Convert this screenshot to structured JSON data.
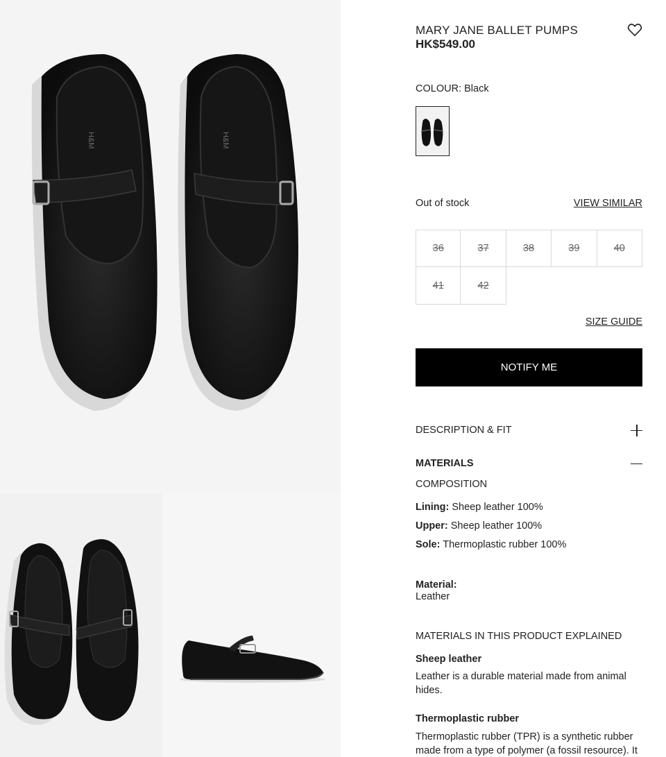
{
  "product": {
    "title": "MARY JANE BALLET PUMPS",
    "price": "HK$549.00"
  },
  "colour": {
    "label": "COLOUR:",
    "value": "Black"
  },
  "stock": {
    "status": "Out of stock",
    "view_similar": "VIEW SIMILAR"
  },
  "sizes": [
    "36",
    "37",
    "38",
    "39",
    "40",
    "41",
    "42"
  ],
  "size_guide": "SIZE GUIDE",
  "notify_button": "NOTIFY ME",
  "accordion": {
    "description": "DESCRIPTION & FIT",
    "materials": "MATERIALS"
  },
  "materials": {
    "composition_heading": "COMPOSITION",
    "composition": [
      {
        "part": "Lining:",
        "value": "Sheep leather 100%"
      },
      {
        "part": "Upper:",
        "value": "Sheep leather 100%"
      },
      {
        "part": "Sole:",
        "value": "Thermoplastic rubber 100%"
      }
    ],
    "material_label": "Material:",
    "material_value": "Leather",
    "explained_heading": "MATERIALS IN THIS PRODUCT EXPLAINED",
    "explained": [
      {
        "name": "Sheep leather",
        "text": "Leather is a durable material made from animal hides."
      },
      {
        "name": "Thermoplastic rubber",
        "text": "Thermoplastic rubber (TPR) is a synthetic rubber made from a type of polymer (a fossil resource). It"
      }
    ]
  },
  "colors": {
    "button_bg": "#000000",
    "button_text": "#ffffff",
    "size_border": "#d9d9d9"
  },
  "icons": [
    "heart-icon",
    "plus-icon",
    "minus-icon"
  ]
}
